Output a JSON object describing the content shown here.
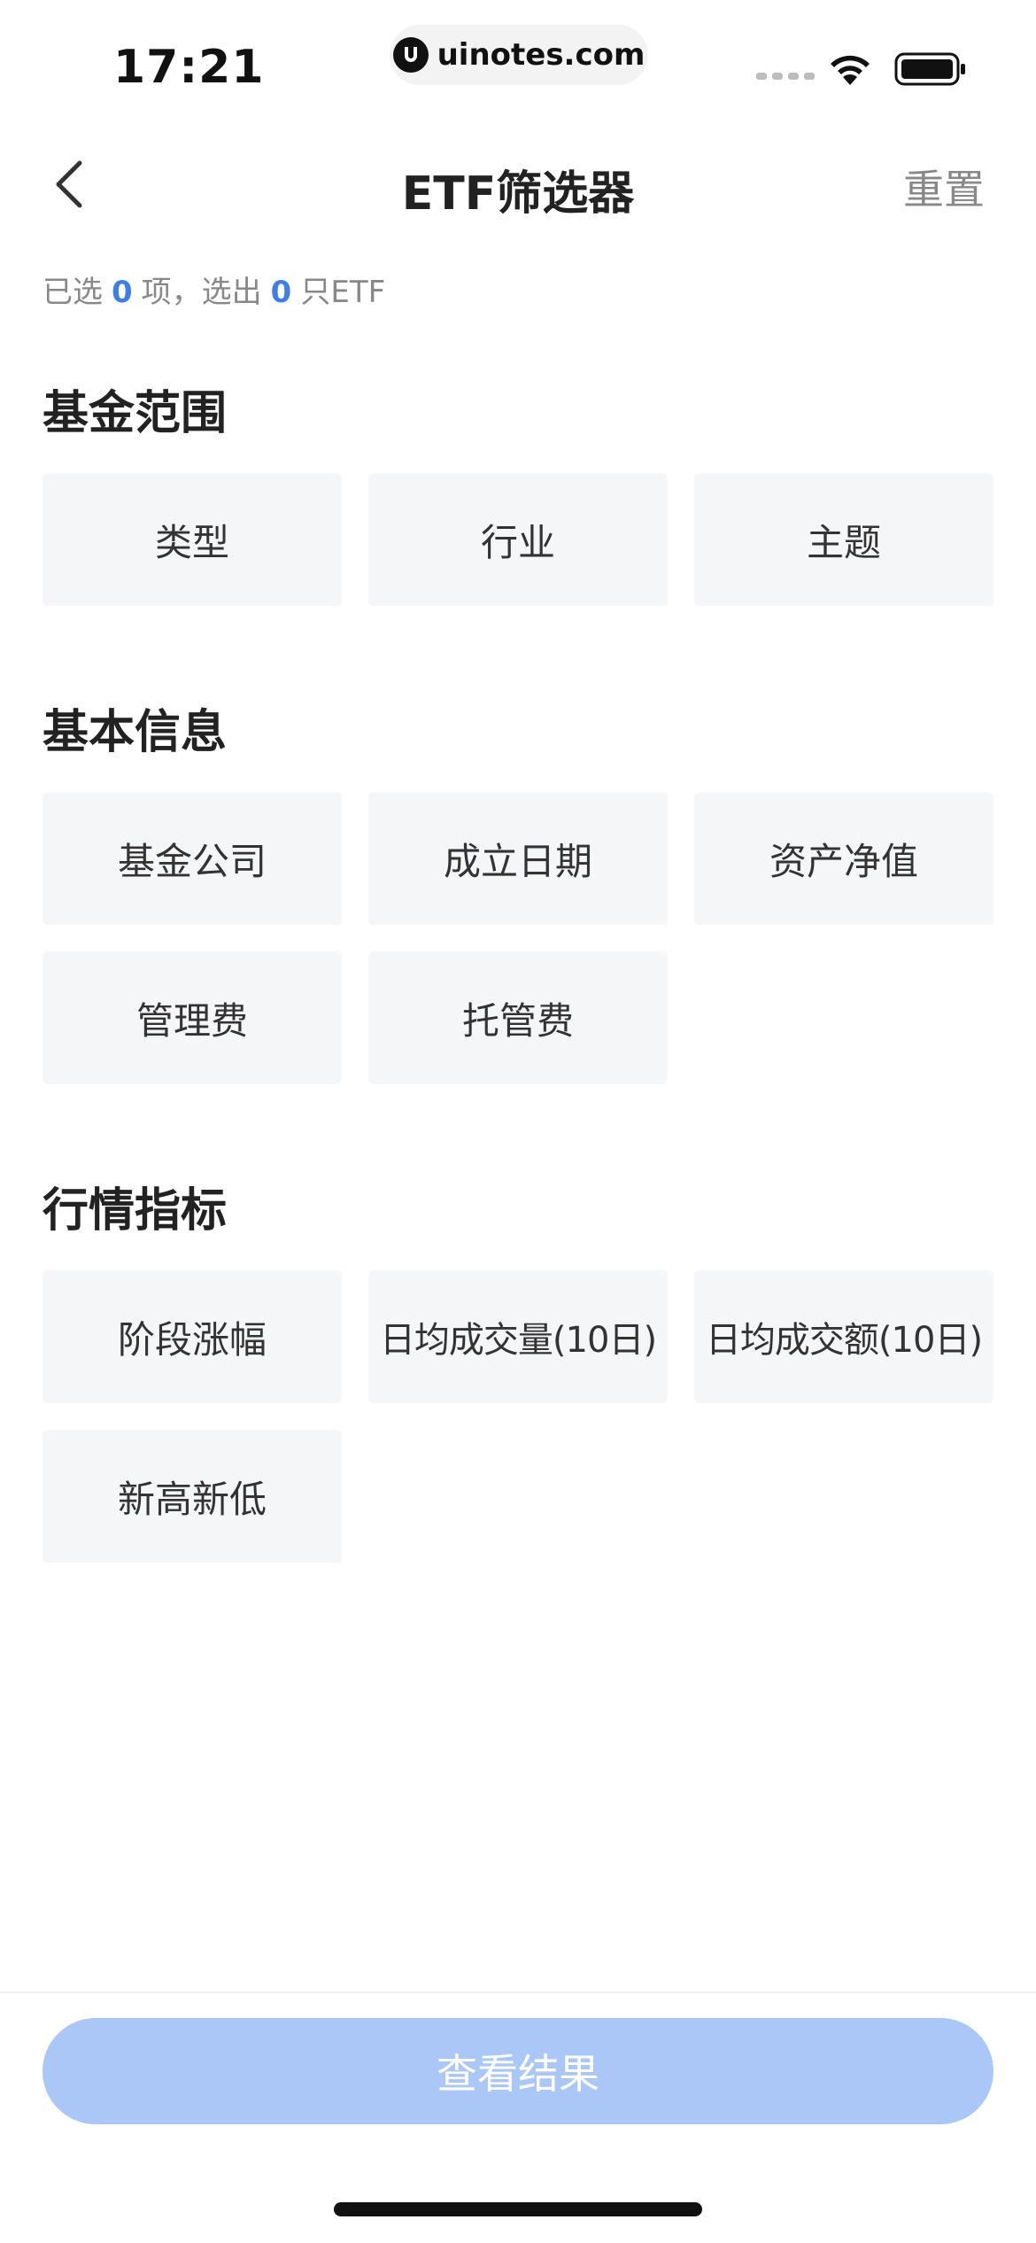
{
  "status_bar": {
    "time": "17:21",
    "site": "uinotes.com"
  },
  "nav": {
    "back_icon": "chevron-left-icon",
    "title": "ETF筛选器",
    "reset_label": "重置"
  },
  "summary": {
    "prefix": "已选",
    "selected_count": "0",
    "middle": "项，选出",
    "etf_count": "0",
    "suffix": "只ETF"
  },
  "sections": {
    "fund_scope": {
      "title": "基金范围",
      "options": [
        "类型",
        "行业",
        "主题"
      ]
    },
    "basic_info": {
      "title": "基本信息",
      "options": [
        "基金公司",
        "成立日期",
        "资产净值",
        "管理费",
        "托管费"
      ]
    },
    "market_indicators": {
      "title": "行情指标",
      "options": [
        "阶段涨幅",
        "日均成交量(10日)",
        "日均成交额(10日)",
        "新高新低"
      ]
    }
  },
  "footer": {
    "result_button": "查看结果"
  },
  "colors": {
    "accent": "#3d7fe6",
    "button_disabled": "#abc7f7",
    "option_bg": "#f5f6f8"
  }
}
